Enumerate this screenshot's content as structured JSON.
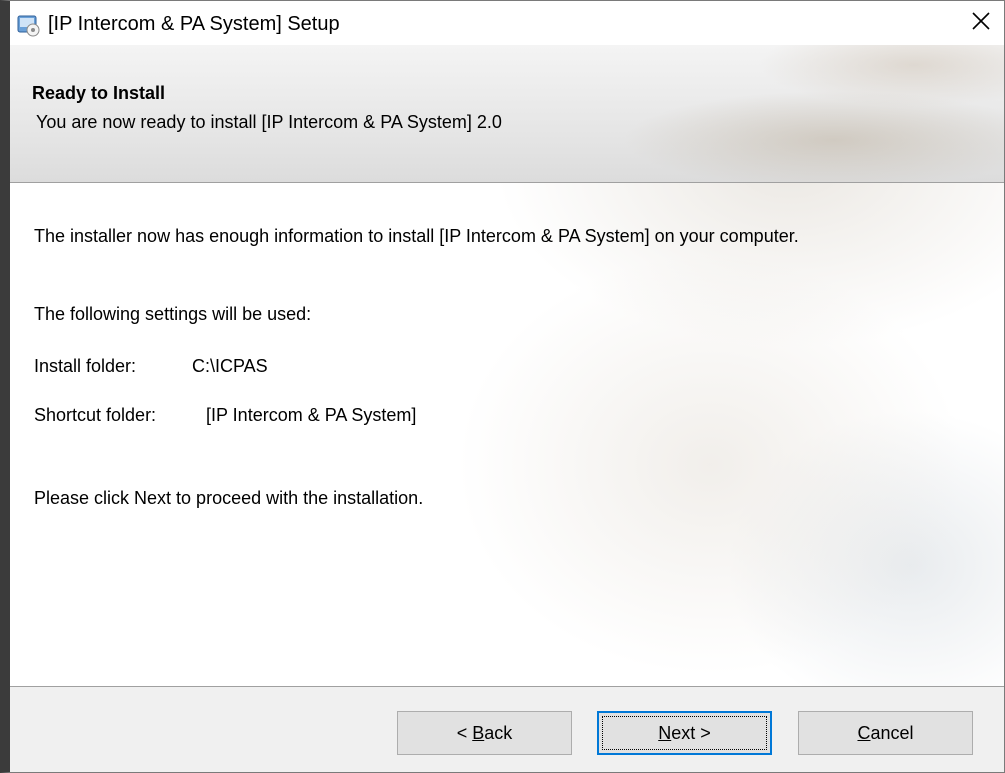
{
  "window": {
    "title": "[IP Intercom & PA System] Setup",
    "icon": "installer-app-icon",
    "close_icon": "close-icon"
  },
  "header": {
    "title": "Ready to Install",
    "subtitle": "You are now ready to install [IP Intercom & PA System] 2.0"
  },
  "body": {
    "intro": "The installer now has enough information to install [IP Intercom & PA System] on your computer.",
    "settings_heading": "The following settings will be used:",
    "install_folder_label": "Install folder:",
    "install_folder_value": "C:\\ICPAS",
    "shortcut_folder_label": "Shortcut folder:",
    "shortcut_folder_value": "[IP Intercom & PA System]",
    "instruction": "Please click Next to proceed with the installation."
  },
  "buttons": {
    "back": {
      "prefix": "< ",
      "mnemonic": "B",
      "rest": "ack"
    },
    "next": {
      "mnemonic": "N",
      "rest": "ext >"
    },
    "cancel": {
      "mnemonic": "C",
      "rest": "ancel"
    }
  },
  "colors": {
    "focus_border": "#0078d7",
    "button_face": "#e1e1e1",
    "footer_bg": "#f0f0f0"
  }
}
